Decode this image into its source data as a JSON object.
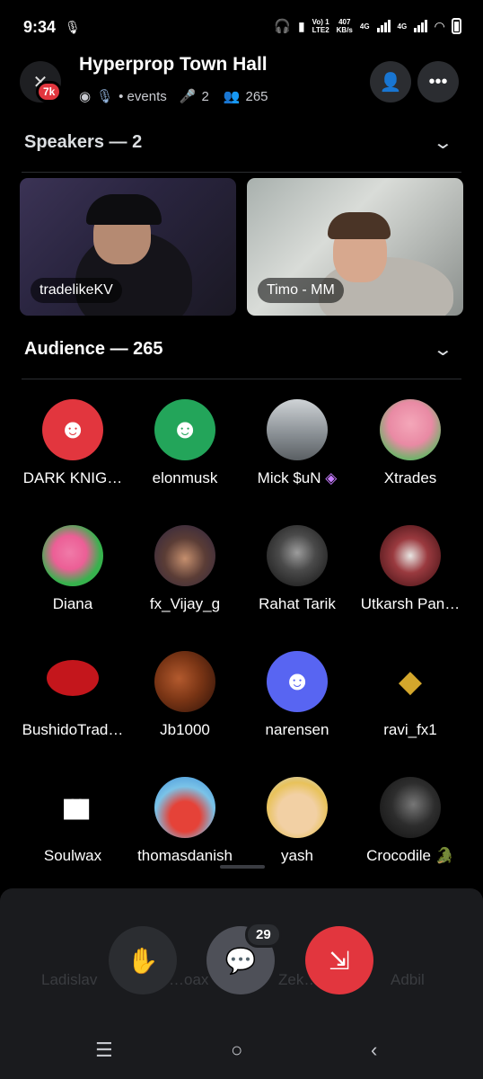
{
  "status": {
    "time": "9:34",
    "vo": "Vo) 1",
    "lte": "LTE2",
    "speed": "407",
    "speed_unit": "KB/s",
    "net1": "4G",
    "net2": "4G"
  },
  "header": {
    "server_badge": "7k",
    "title": "Hyperprop Town Hall",
    "events": "• events",
    "speaker_count": "2",
    "listener_count": "265"
  },
  "speakers": {
    "heading": "Speakers — 2",
    "tiles": [
      {
        "name": "tradelikeKV"
      },
      {
        "name": "Timo - MM"
      }
    ]
  },
  "audience": {
    "heading": "Audience — 265",
    "members": [
      {
        "name": "DARK KNIG…",
        "avatar": "discord-red"
      },
      {
        "name": "elonmusk",
        "avatar": "discord-green"
      },
      {
        "name": "Mick $uN",
        "avatar": "photo"
      },
      {
        "name": "Xtrades",
        "avatar": "cartoon"
      },
      {
        "name": "Diana",
        "avatar": "cartoon"
      },
      {
        "name": "fx_Vijay_g",
        "avatar": "photo"
      },
      {
        "name": "Rahat Tarik",
        "avatar": "photo"
      },
      {
        "name": "Utkarsh Pan…",
        "avatar": "photo"
      },
      {
        "name": "BushidoTrad…",
        "avatar": "logo"
      },
      {
        "name": "Jb1000",
        "avatar": "photo"
      },
      {
        "name": "narensen",
        "avatar": "discord-blurple"
      },
      {
        "name": "ravi_fx1",
        "avatar": "logo"
      },
      {
        "name": "Soulwax",
        "avatar": "logo"
      },
      {
        "name": "thomasdanish",
        "avatar": "photo"
      },
      {
        "name": "yash",
        "avatar": "cartoon"
      },
      {
        "name": "Crocodile",
        "avatar": "photo"
      }
    ],
    "hidden_row": [
      "Ladislav",
      "…oax",
      "Zek…",
      "Adbil"
    ]
  },
  "controls": {
    "chat_count": "29"
  },
  "colors": {
    "red": "#e2363e",
    "green": "#23a55a",
    "blurple": "#5865f2",
    "bg": "#000000",
    "sheet": "#1a1b1e"
  }
}
